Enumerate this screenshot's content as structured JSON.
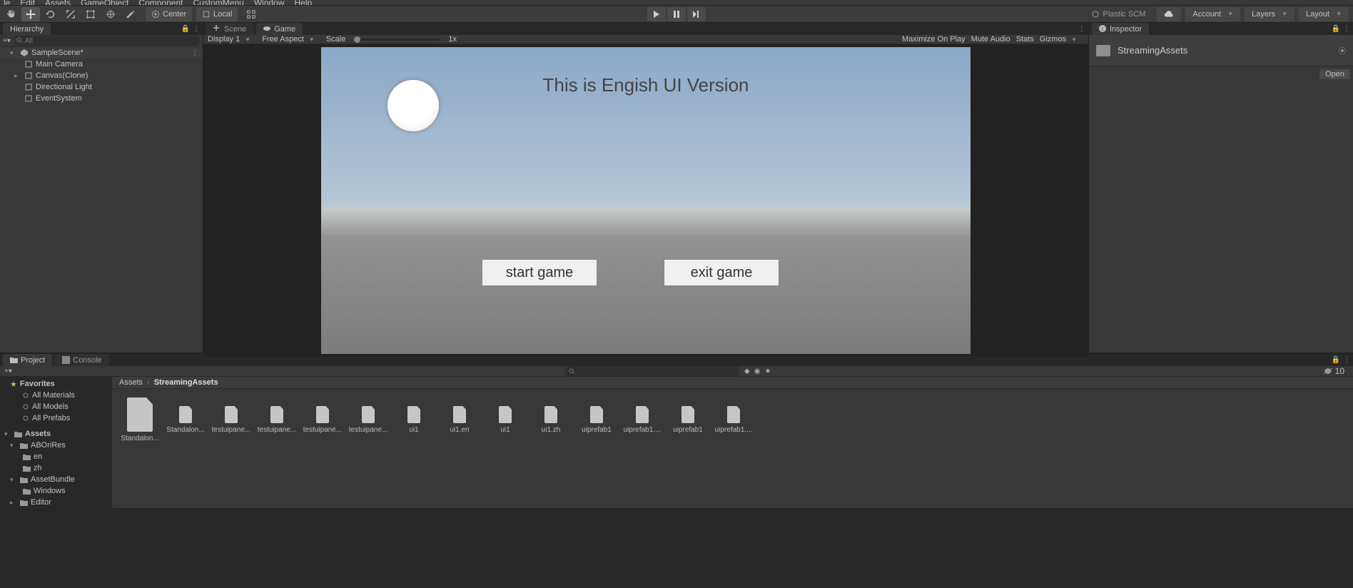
{
  "menu": {
    "file": "le",
    "edit": "Edit",
    "assets": "Assets",
    "gameobject": "GameObject",
    "component": "Component",
    "custommenu": "CustomMenu",
    "window": "Window",
    "help": "Help"
  },
  "toolbar": {
    "center": "Center",
    "local": "Local",
    "plastic": "Plastic SCM",
    "account": "Account",
    "layers": "Layers",
    "layout": "Layout"
  },
  "hierarchy": {
    "tab": "Hierarchy",
    "search": "All",
    "items": [
      {
        "label": "SampleScene*",
        "type": "scene"
      },
      {
        "label": "Main Camera",
        "type": "go"
      },
      {
        "label": "Canvas(Clone)",
        "type": "go",
        "expandable": true
      },
      {
        "label": "Directional Light",
        "type": "go"
      },
      {
        "label": "EventSystem",
        "type": "go"
      }
    ]
  },
  "center": {
    "tabs": {
      "scene": "Scene",
      "game": "Game"
    },
    "display": "Display 1",
    "aspect": "Free Aspect",
    "scale": "Scale",
    "scaleval": "1x",
    "maxplay": "Maximize On Play",
    "mute": "Mute Audio",
    "stats": "Stats",
    "gizmos": "Gizmos",
    "game": {
      "title": "This is Engish UI Version",
      "btn1": "start game",
      "btn2": "exit game"
    }
  },
  "inspector": {
    "tab": "Inspector",
    "name": "StreamingAssets",
    "open": "Open"
  },
  "project": {
    "tab": "Project",
    "console": "Console",
    "favorites": "Favorites",
    "allmat": "All Materials",
    "allmod": "All Models",
    "allpref": "All Prefabs",
    "assets": "Assets",
    "aborires": "ABOriRes",
    "en": "en",
    "zh": "zh",
    "assetbundle": "AssetBundle",
    "windows": "Windows",
    "editor": "Editor",
    "bc_assets": "Assets",
    "bc_cur": "StreamingAssets",
    "files": [
      "Standalon...",
      "Standalon...",
      "testuipane...",
      "testuipane...",
      "testuipane...",
      "testuipane...",
      "ui1",
      "ui1.en",
      "ui1",
      "ui1.zh",
      "uiprefab1",
      "uiprefab1....",
      "uiprefab1",
      "uiprefab1...."
    ],
    "count": "10"
  }
}
